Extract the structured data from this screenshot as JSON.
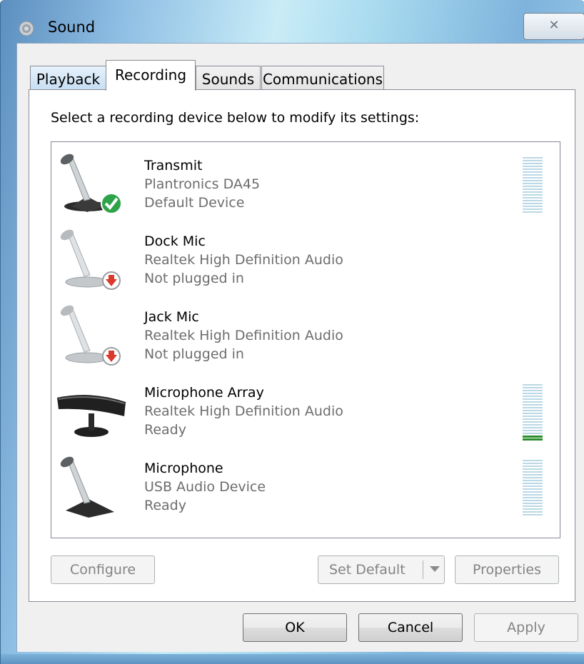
{
  "window": {
    "title": "Sound",
    "close_glyph": "✕"
  },
  "tabs": [
    {
      "label": "Playback"
    },
    {
      "label": "Recording"
    },
    {
      "label": "Sounds"
    },
    {
      "label": "Communications"
    }
  ],
  "instruction": "Select a recording device below to modify its settings:",
  "devices": [
    {
      "name": "Transmit",
      "description": "Plantronics DA45",
      "status": "Default Device",
      "icon": "microphone-default-icon",
      "level": 0
    },
    {
      "name": "Dock Mic",
      "description": "Realtek High Definition Audio",
      "status": "Not plugged in",
      "icon": "microphone-unplugged-icon"
    },
    {
      "name": "Jack Mic",
      "description": "Realtek High Definition Audio",
      "status": "Not plugged in",
      "icon": "microphone-unplugged-icon"
    },
    {
      "name": "Microphone Array",
      "description": "Realtek High Definition Audio",
      "status": "Ready",
      "icon": "microphone-array-icon",
      "level": 0.1
    },
    {
      "name": "Microphone",
      "description": "USB Audio Device",
      "status": "Ready",
      "icon": "microphone-icon",
      "level": 0
    }
  ],
  "buttons": {
    "configure": "Configure",
    "set_default": "Set Default",
    "properties": "Properties",
    "ok": "OK",
    "cancel": "Cancel",
    "apply": "Apply"
  },
  "colors": {
    "meter_idle": "#bad8e5",
    "meter_active": "#2a8d2a",
    "default_badge": "#2ea34a",
    "unplugged_badge": "#d93a2b"
  }
}
